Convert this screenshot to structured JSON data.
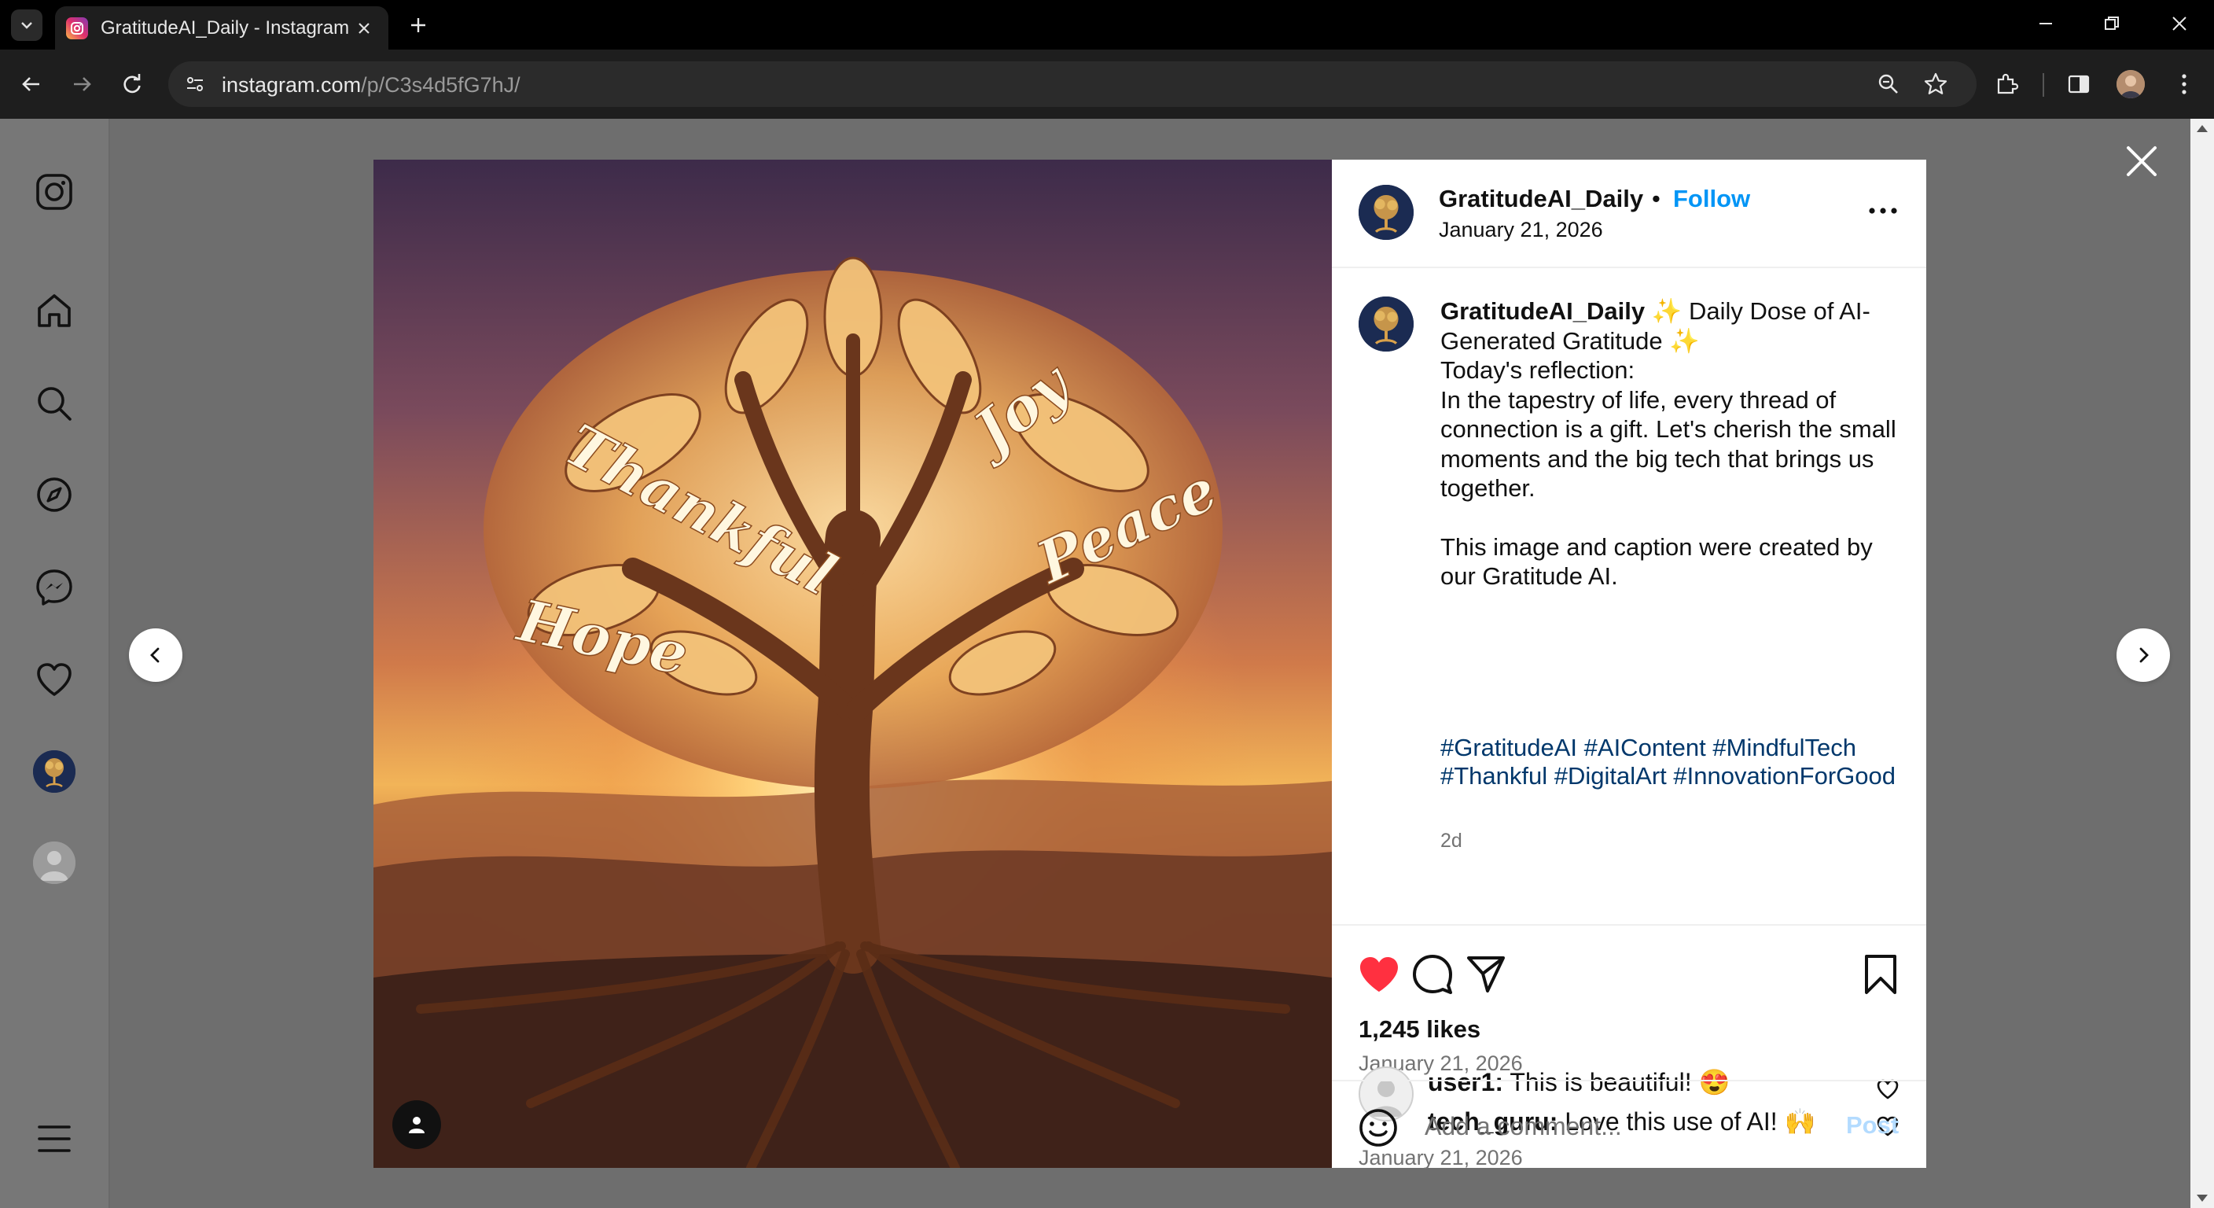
{
  "browser": {
    "tab_title": "GratitudeAI_Daily - Instagram",
    "url_host": "instagram.com",
    "url_path": "/p/C3s4d5fG7hJ/"
  },
  "post": {
    "image_words": [
      "Thankful",
      "Joy",
      "Hope",
      "Peace"
    ],
    "header": {
      "username": "GratitudeAI_Daily",
      "separator": "•",
      "follow_label": "Follow",
      "date": "January 21, 2026"
    },
    "caption": {
      "username": "GratitudeAI_Daily",
      "sparkle": "✨",
      "title_text": " Daily Dose of AI-Generated Gratitude ",
      "line_reflection": "Today's reflection:",
      "body": "In the tapestry of life, every thread of connection is a gift. Let's cherish the small moments and the big tech that brings us together.",
      "disclaimer": "This image and caption were created by our Gratitude AI.",
      "hashtags": "#GratitudeAI #AIContent #MindfulTech #Thankful #DigitalArt #InnovationForGood",
      "relative_time": "2d"
    },
    "likes_text": "1,245 likes",
    "likes_date": "January 21, 2026",
    "comments": [
      {
        "user": "user1:",
        "text": " This is beautiful! 😍"
      },
      {
        "user": "tech_guru:",
        "text": " Love this use of AI! 🙌"
      }
    ],
    "comments_date": "January 21, 2026",
    "comment_placeholder": "Add a comment...",
    "post_label": "Post"
  },
  "colors": {
    "like_red": "#ff3040",
    "follow_blue": "#0095f6",
    "hashtag_blue": "#00376b",
    "post_disabled": "#b3dbff"
  },
  "icons": {
    "sidebar": [
      "instagram-icon",
      "home-icon",
      "search-icon",
      "explore-icon",
      "messenger-icon",
      "notifications-icon",
      "profile-avatar",
      "user-avatar",
      "more-menu-icon"
    ],
    "actions": [
      "like-icon",
      "comment-icon",
      "share-icon",
      "save-icon"
    ]
  }
}
